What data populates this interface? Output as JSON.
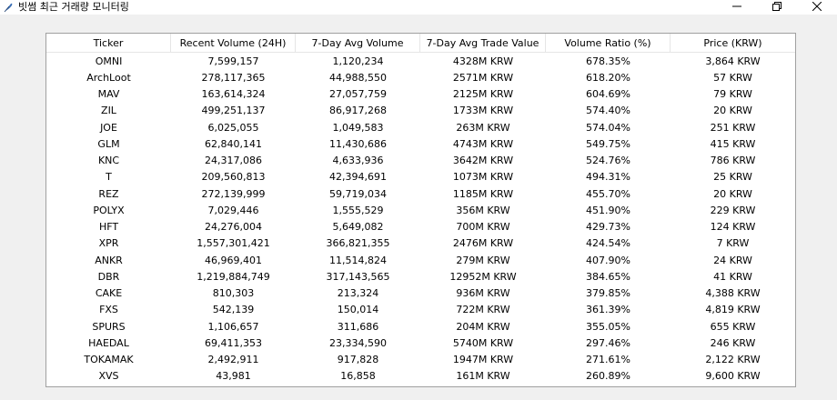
{
  "window": {
    "title": "빗썸 최근 거래량 모니터링",
    "minimize_icon": "minimize-icon",
    "maximize_icon": "restore-icon",
    "close_icon": "close-icon"
  },
  "table": {
    "columns": [
      "Ticker",
      "Recent Volume (24H)",
      "7-Day Avg Volume",
      "7-Day Avg Trade Value",
      "Volume Ratio (%)",
      "Price (KRW)"
    ],
    "rows": [
      [
        "OMNI",
        "7,599,157",
        "1,120,234",
        "4328M KRW",
        "678.35%",
        "3,864 KRW"
      ],
      [
        "ArchLoot",
        "278,117,365",
        "44,988,550",
        "2571M KRW",
        "618.20%",
        "57 KRW"
      ],
      [
        "MAV",
        "163,614,324",
        "27,057,759",
        "2125M KRW",
        "604.69%",
        "79 KRW"
      ],
      [
        "ZIL",
        "499,251,137",
        "86,917,268",
        "1733M KRW",
        "574.40%",
        "20 KRW"
      ],
      [
        "JOE",
        "6,025,055",
        "1,049,583",
        "263M KRW",
        "574.04%",
        "251 KRW"
      ],
      [
        "GLM",
        "62,840,141",
        "11,430,686",
        "4743M KRW",
        "549.75%",
        "415 KRW"
      ],
      [
        "KNC",
        "24,317,086",
        "4,633,936",
        "3642M KRW",
        "524.76%",
        "786 KRW"
      ],
      [
        "T",
        "209,560,813",
        "42,394,691",
        "1073M KRW",
        "494.31%",
        "25 KRW"
      ],
      [
        "REZ",
        "272,139,999",
        "59,719,034",
        "1185M KRW",
        "455.70%",
        "20 KRW"
      ],
      [
        "POLYX",
        "7,029,446",
        "1,555,529",
        "356M KRW",
        "451.90%",
        "229 KRW"
      ],
      [
        "HFT",
        "24,276,004",
        "5,649,082",
        "700M KRW",
        "429.73%",
        "124 KRW"
      ],
      [
        "XPR",
        "1,557,301,421",
        "366,821,355",
        "2476M KRW",
        "424.54%",
        "7 KRW"
      ],
      [
        "ANKR",
        "46,969,401",
        "11,514,824",
        "279M KRW",
        "407.90%",
        "24 KRW"
      ],
      [
        "DBR",
        "1,219,884,749",
        "317,143,565",
        "12952M KRW",
        "384.65%",
        "41 KRW"
      ],
      [
        "CAKE",
        "810,303",
        "213,324",
        "936M KRW",
        "379.85%",
        "4,388 KRW"
      ],
      [
        "FXS",
        "542,139",
        "150,014",
        "722M KRW",
        "361.39%",
        "4,819 KRW"
      ],
      [
        "SPURS",
        "1,106,657",
        "311,686",
        "204M KRW",
        "355.05%",
        "655 KRW"
      ],
      [
        "HAEDAL",
        "69,411,353",
        "23,334,590",
        "5740M KRW",
        "297.46%",
        "246 KRW"
      ],
      [
        "TOKAMAK",
        "2,492,911",
        "917,828",
        "1947M KRW",
        "271.61%",
        "2,122 KRW"
      ],
      [
        "XVS",
        "43,981",
        "16,858",
        "161M KRW",
        "260.89%",
        "9,600 KRW"
      ]
    ]
  }
}
